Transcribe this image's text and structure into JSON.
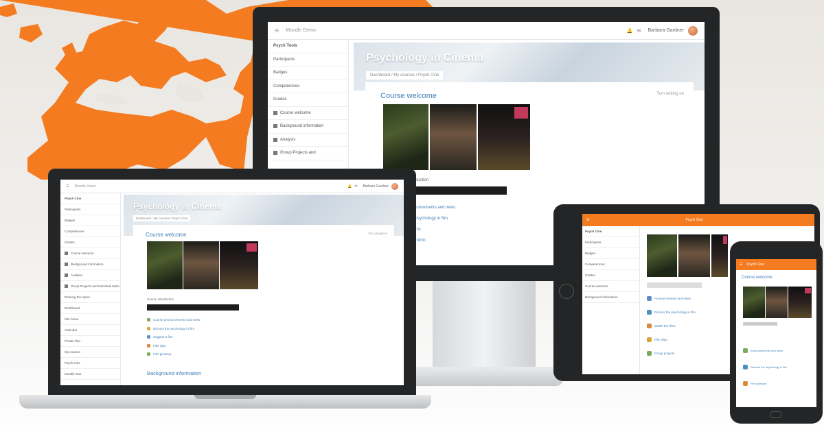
{
  "background": {
    "accent": "#f47b20"
  },
  "monitor": {
    "brand": "Moodle Demo",
    "user_name": "Barbara Gardner",
    "sidebar": [
      "Psych Tools",
      "Participants",
      "Badges",
      "Competencies",
      "Grades",
      "Course welcome",
      "Background information",
      "Analysis",
      "Group Projects and"
    ],
    "hero_title": "Psychology in Cinema",
    "breadcrumb": "Dashboard / My courses / Psych Cine",
    "card_title": "Course welcome",
    "settings": "Turn editing on",
    "media_label": "Course introduction",
    "links": [
      "Course announcements and news",
      "Discuss the psychology in film",
      "Watch the films",
      "Assignment rubric"
    ]
  },
  "laptop": {
    "brand": "Moodle Demo",
    "user_name": "Barbara Gardner",
    "sidebar": [
      "Psych Cine",
      "Participants",
      "Badges",
      "Competencies",
      "Grades",
      "Course welcome",
      "Background information",
      "Analysis",
      "Group Projects and Individual tasks",
      "Defining the topics",
      "Dashboard",
      "Site home",
      "Calendar",
      "Private files",
      "My courses",
      "Psych Cine",
      "Moodle Tour"
    ],
    "hero_title": "Psychology in Cinema",
    "breadcrumb": "Dashboard / My courses / Psych Cine",
    "card_title": "Course welcome",
    "settings": "Your progress",
    "media_label": "Course introduction",
    "links": [
      "Course announcements and news",
      "Discuss the psychology in film",
      "Suggest a film",
      "Film clips",
      "Film glossary"
    ],
    "section_title": "Background information"
  },
  "tablet": {
    "header": "Psych Cine",
    "sidebar": [
      "Psych Cine",
      "Participants",
      "Badges",
      "Competencies",
      "Grades",
      "Course welcome",
      "Background information"
    ],
    "rows": [
      "Announcements and news",
      "Discuss the psychology in film",
      "Watch the films",
      "Film clips",
      "Group projects"
    ]
  },
  "phone": {
    "header": "Psych Cine",
    "card_title": "Course welcome",
    "rows": [
      "Announcements and news",
      "Discuss the psychology in film",
      "Film glossary"
    ]
  }
}
